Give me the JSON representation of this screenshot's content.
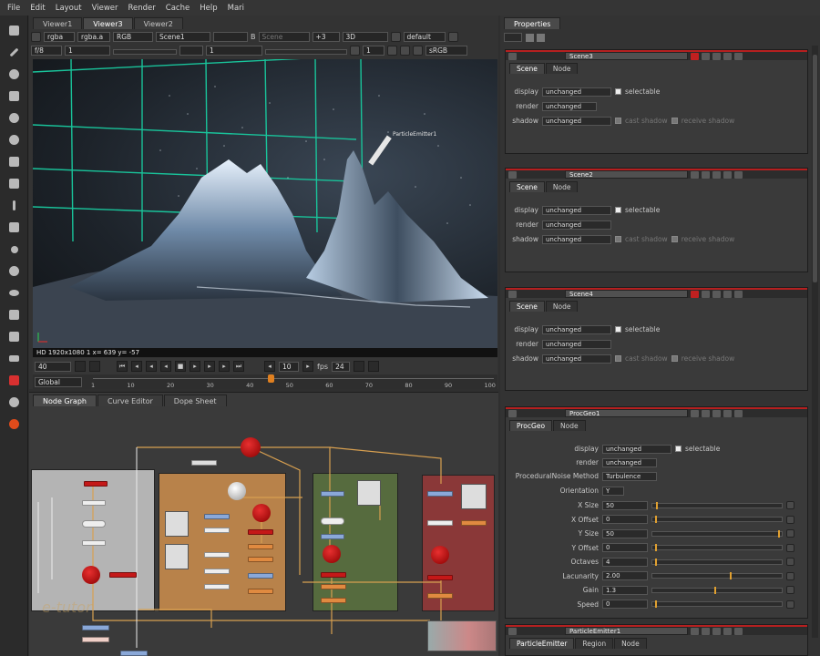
{
  "menu": [
    "File",
    "Edit",
    "Layout",
    "Viewer",
    "Render",
    "Cache",
    "Help",
    "Mari"
  ],
  "viewer": {
    "tabs": [
      "Viewer1",
      "Viewer3",
      "Viewer2"
    ],
    "channels": "rgba",
    "layer": "rgba.a",
    "display": "RGB",
    "input_a": "Scene1",
    "input_b_label": "B",
    "input_b": "Scene",
    "gain": "+3",
    "mode": "3D",
    "lut": "default",
    "gamma": "1",
    "frame_val": "f/8",
    "zoom": "1",
    "proxy": "1",
    "colorspace": "sRGB",
    "status": "HD 1920x1080 1  x= 639 y= -57",
    "frame": "40",
    "step": "10",
    "fps_label": "fps",
    "fps": "24",
    "range_mode": "Global",
    "ticks": [
      "1",
      "10",
      "20",
      "30",
      "40",
      "50",
      "60",
      "70",
      "80",
      "90",
      "100"
    ],
    "emitter_label": "ParticleEmitter1"
  },
  "nodegraph": {
    "tabs": [
      "Node Graph",
      "Curve Editor",
      "Dope Sheet"
    ],
    "watermark": "e-tutor"
  },
  "properties": {
    "title": "Properties",
    "panels": [
      {
        "name": "Scene3",
        "tabs": [
          "Scene",
          "Node"
        ],
        "display": "unchanged",
        "render": "unchanged",
        "shadow": "unchanged"
      },
      {
        "name": "Scene2",
        "tabs": [
          "Scene",
          "Node"
        ],
        "display": "unchanged",
        "render": "unchanged",
        "shadow": "unchanged"
      },
      {
        "name": "Scene4",
        "tabs": [
          "Scene",
          "Node"
        ],
        "display": "unchanged",
        "render": "unchanged",
        "shadow": "unchanged"
      }
    ],
    "labels": {
      "display": "display",
      "render": "render",
      "shadow": "shadow",
      "selectable": "selectable",
      "cast_shadow": "cast shadow",
      "receive_shadow": "receive shadow"
    },
    "procgeo": {
      "name": "ProcGeo1",
      "tabs": [
        "ProcGeo",
        "Node"
      ],
      "display": "unchanged",
      "render": "unchanged",
      "method_label": "ProceduralNoise Method",
      "method": "Turbulence",
      "orientation_label": "Orientation",
      "orientation": "Y",
      "fields": [
        {
          "label": "X Size",
          "value": "50"
        },
        {
          "label": "X Offset",
          "value": "0"
        },
        {
          "label": "Y Size",
          "value": "50"
        },
        {
          "label": "Y Offset",
          "value": "0"
        },
        {
          "label": "Octaves",
          "value": "4"
        },
        {
          "label": "Lacunarity",
          "value": "2.00"
        },
        {
          "label": "Gain",
          "value": "1.3"
        },
        {
          "label": "Speed",
          "value": "0"
        }
      ]
    },
    "emitter": {
      "name": "ParticleEmitter1",
      "tabs": [
        "ParticleEmitter",
        "Region",
        "Node"
      ]
    }
  },
  "colors": {
    "accent": "#b52020",
    "node_red": "#c41818",
    "backdrop_gray": "#b4b4b4",
    "backdrop_orange": "#b8824a",
    "backdrop_green": "#566b3e",
    "backdrop_red": "#8a3838",
    "grid": "#19c39a"
  }
}
